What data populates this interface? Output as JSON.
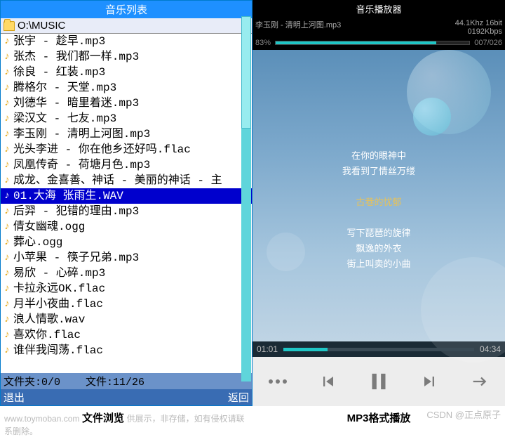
{
  "browser": {
    "title": "音乐列表",
    "path": "O:\\MUSIC",
    "items": [
      {
        "name": "张宇 - 趁早.mp3",
        "selected": false
      },
      {
        "name": "张杰 - 我们都一样.mp3",
        "selected": false
      },
      {
        "name": "徐良 - 红装.mp3",
        "selected": false
      },
      {
        "name": "腾格尔 - 天堂.mp3",
        "selected": false
      },
      {
        "name": "刘德华 - 暗里着迷.mp3",
        "selected": false
      },
      {
        "name": "梁汉文 - 七友.mp3",
        "selected": false
      },
      {
        "name": "李玉刚 - 清明上河图.mp3",
        "selected": false
      },
      {
        "name": "光头李进 - 你在他乡还好吗.flac",
        "selected": false
      },
      {
        "name": "凤凰传奇 - 荷塘月色.mp3",
        "selected": false
      },
      {
        "name": "成龙、金喜善、神话 - 美丽的神话 - 主",
        "selected": false
      },
      {
        "name": "01.大海 张雨生.WAV",
        "selected": true
      },
      {
        "name": "后羿 - 犯错的理由.mp3",
        "selected": false
      },
      {
        "name": "倩女幽魂.ogg",
        "selected": false
      },
      {
        "name": "葬心.ogg",
        "selected": false
      },
      {
        "name": "小苹果 - 筷子兄弟.mp3",
        "selected": false
      },
      {
        "name": "易欣 - 心碎.mp3",
        "selected": false
      },
      {
        "name": "卡拉永远OK.flac",
        "selected": false
      },
      {
        "name": "月半小夜曲.flac",
        "selected": false
      },
      {
        "name": "浪人情歌.wav",
        "selected": false
      },
      {
        "name": "喜欢你.flac",
        "selected": false
      },
      {
        "name": "谁伴我闯荡.flac",
        "selected": false
      }
    ],
    "status": {
      "folders": "文件夹:0/0",
      "files": "文件:11/26"
    },
    "bottom": {
      "exit": "退出",
      "back": "返回"
    }
  },
  "player": {
    "title": "音乐播放器",
    "now": {
      "left": "李玉刚 - 清明上河图.mp3",
      "rate": "44.1Khz  16bit",
      "bitrate": "0192Kbps",
      "percent": "83%",
      "count": "007/026"
    },
    "lyrics": [
      "在你的眼神中",
      "我看到了情丝万缕",
      "",
      "古巷的忧郁",
      "",
      "写下琵琶的旋律",
      "飘逸的外衣",
      "街上叫卖的小曲"
    ],
    "lyric_highlight_index": 3,
    "time": {
      "current": "01:01",
      "total": "04:34"
    }
  },
  "footer": {
    "copy_left": "www.toymoban.com",
    "copy_mid": "供展示，非存储，如有侵权请联系删除。",
    "label_left": "文件浏览",
    "label_right": "MP3格式播放",
    "watermark": "CSDN @正点原子"
  }
}
